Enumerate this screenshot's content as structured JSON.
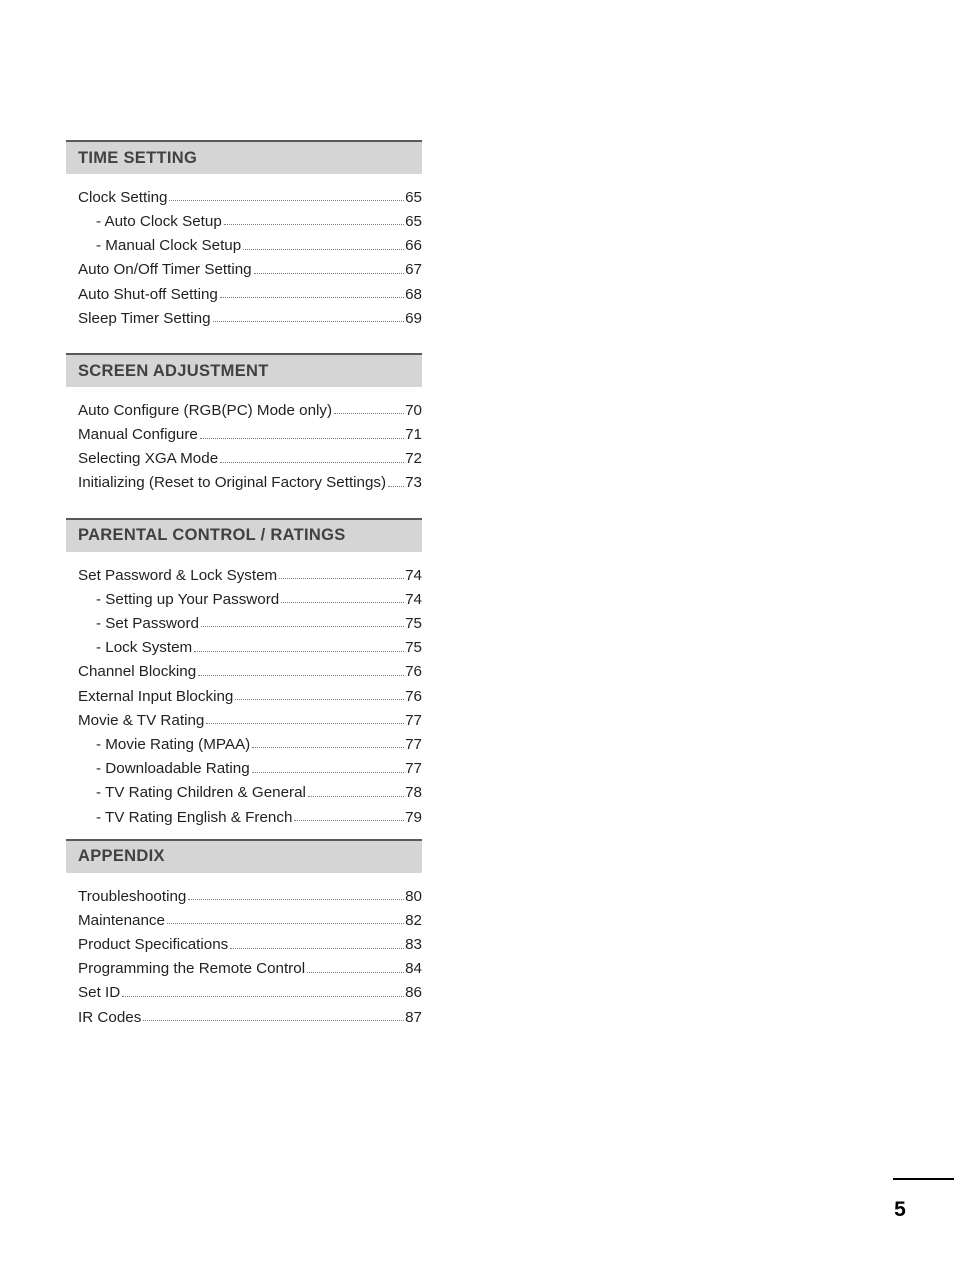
{
  "document": {
    "page_number": "5"
  },
  "sections": [
    {
      "title": "TIME SETTING",
      "entries": [
        {
          "label": "Clock Setting",
          "page": "65",
          "sub": false
        },
        {
          "label": "- Auto Clock Setup",
          "page": "65",
          "sub": true
        },
        {
          "label": "- Manual Clock Setup",
          "page": "66",
          "sub": true
        },
        {
          "label": "Auto On/Off Timer Setting",
          "page": "67",
          "sub": false
        },
        {
          "label": "Auto Shut-off Setting",
          "page": "68",
          "sub": false
        },
        {
          "label": "Sleep Timer Setting",
          "page": "69",
          "sub": false
        }
      ]
    },
    {
      "title": "SCREEN ADJUSTMENT",
      "entries": [
        {
          "label": "Auto Configure (RGB(PC) Mode only)",
          "page": "70",
          "sub": false
        },
        {
          "label": "Manual Configure",
          "page": "71",
          "sub": false
        },
        {
          "label": "Selecting XGA Mode",
          "page": "72",
          "sub": false
        },
        {
          "label": "Initializing (Reset to Original Factory Settings)",
          "page": "73",
          "sub": false
        }
      ]
    },
    {
      "title": "PARENTAL CONTROL / RATINGS",
      "entries": [
        {
          "label": "Set Password & Lock System",
          "page": "74",
          "sub": false
        },
        {
          "label": "- Setting up Your Password",
          "page": "74",
          "sub": true
        },
        {
          "label": "- Set Password",
          "page": "75",
          "sub": true
        },
        {
          "label": "- Lock System",
          "page": "75",
          "sub": true
        },
        {
          "label": "Channel Blocking",
          "page": "76",
          "sub": false
        },
        {
          "label": "External Input Blocking",
          "page": "76",
          "sub": false
        },
        {
          "label": "Movie & TV Rating",
          "page": "77",
          "sub": false
        },
        {
          "label": "- Movie Rating (MPAA)",
          "page": "77",
          "sub": true
        },
        {
          "label": "- Downloadable Rating",
          "page": "77",
          "sub": true
        },
        {
          "label": "- TV Rating Children & General",
          "page": "78",
          "sub": true
        },
        {
          "label": "- TV Rating English & French",
          "page": "79",
          "sub": true
        }
      ]
    },
    {
      "title": "APPENDIX",
      "entries": [
        {
          "label": "Troubleshooting",
          "page": "80",
          "sub": false
        },
        {
          "label": "Maintenance",
          "page": "82",
          "sub": false
        },
        {
          "label": "Product Specifications",
          "page": "83",
          "sub": false
        },
        {
          "label": "Programming the Remote Control",
          "page": "84",
          "sub": false
        },
        {
          "label": "Set ID",
          "page": "86",
          "sub": false
        },
        {
          "label": "IR Codes",
          "page": "87",
          "sub": false
        }
      ]
    }
  ],
  "layout": {
    "section_gaps": [
      26,
      26,
      13,
      0
    ]
  },
  "colors": {
    "header_bar": "#d5d5d5",
    "header_rule": "#58585a",
    "header_text": "#414042",
    "body_text": "#231f20",
    "leader_dots": "#7b7b7d"
  }
}
